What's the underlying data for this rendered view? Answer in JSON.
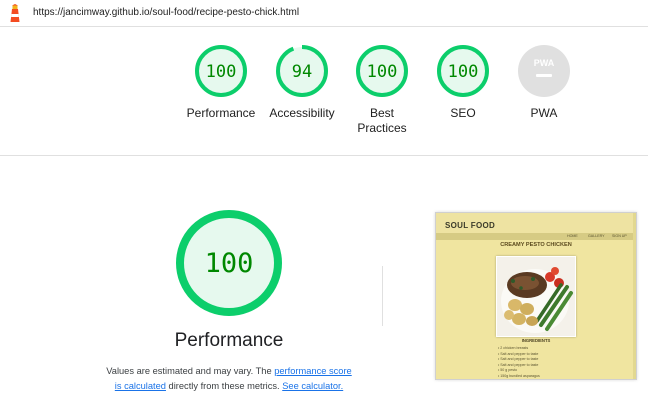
{
  "header": {
    "url": "https://jancimway.github.io/soul-food/recipe-pesto-chick.html"
  },
  "colors": {
    "pass": "#0cce6b",
    "pass_text": "#008800",
    "pass_fill": "#e6f9ee",
    "na": "#cccccc"
  },
  "gauges": [
    {
      "score": "100",
      "label": "Performance",
      "value": 100
    },
    {
      "score": "94",
      "label": "Accessibility",
      "value": 94
    },
    {
      "score": "100",
      "label": "Best Practices",
      "label_lines": [
        "Best",
        "Practices"
      ],
      "value": 100
    },
    {
      "score": "100",
      "label": "SEO",
      "value": 100
    },
    {
      "score": "PWA",
      "label": "PWA",
      "value": null
    }
  ],
  "performance": {
    "score": "100",
    "title": "Performance",
    "note_pre": "Values are estimated and may vary. The ",
    "link_score": "performance score is calculated",
    "link_score_l1": "performance score",
    "link_score_l2": "is calculated",
    "note_mid": " directly from these metrics. ",
    "link_calc": "See calculator."
  },
  "screenshot": {
    "brand": "SOUL FOOD",
    "nav": [
      "HOME",
      "GALLERY",
      "SIGN UP"
    ],
    "title": "CREAMY PESTO CHICKEN",
    "ingredients_heading": "INGREDIENTS",
    "ingredients": [
      "2 chicken breasts",
      "Salt and pepper to taste",
      "Salt and pepper to taste",
      "Salt and pepper to taste",
      "50 g pesto",
      "150g bundled asparagus"
    ]
  }
}
